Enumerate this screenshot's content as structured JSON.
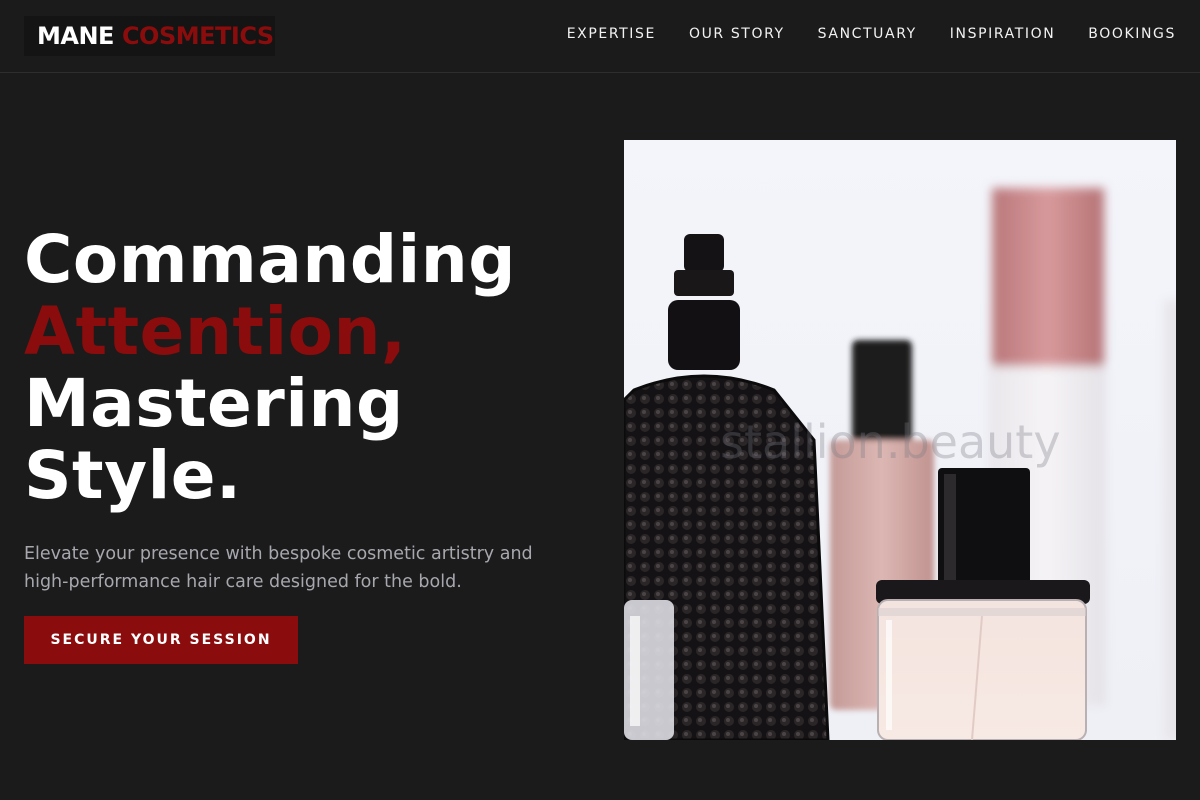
{
  "brand": {
    "word1": "MANE",
    "word2": "COSMETICS",
    "accent_color": "#8b0c0c"
  },
  "nav": {
    "items": [
      {
        "label": "EXPERTISE"
      },
      {
        "label": "OUR STORY"
      },
      {
        "label": "SANCTUARY"
      },
      {
        "label": "INSPIRATION"
      },
      {
        "label": "BOOKINGS"
      }
    ]
  },
  "hero": {
    "headline": {
      "line1": "Commanding",
      "line2": "Attention,",
      "line3": "Mastering",
      "line4": "Style."
    },
    "subtext": "Elevate your presence with bespoke cosmetic artistry and high-performance hair care designed for the bold.",
    "cta_label": "SECURE YOUR SESSION",
    "image": {
      "subject": "perfume-bottles",
      "watermark": "stallion.beauty"
    }
  }
}
